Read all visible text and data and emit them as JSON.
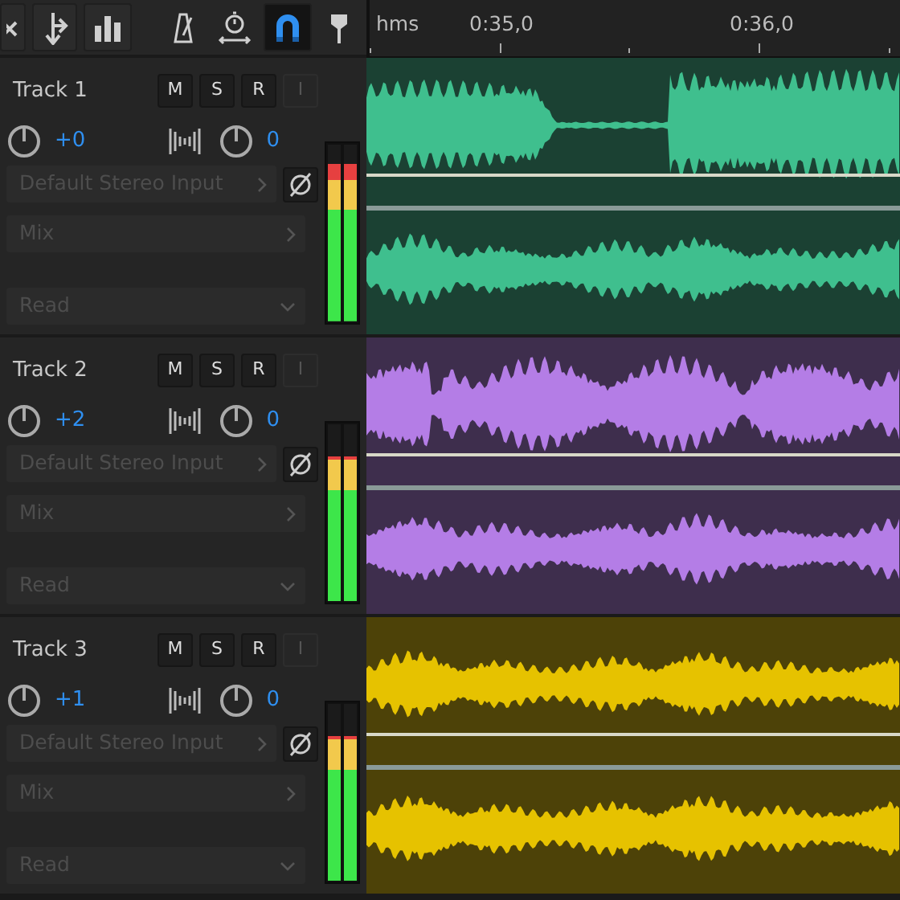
{
  "toolbar": {
    "left_tools": [
      {
        "selected": false
      },
      {
        "selected": false
      },
      {
        "selected": false
      }
    ],
    "right_tools": [
      {
        "selected": false
      },
      {
        "selected": false
      },
      {
        "selected": true
      },
      {
        "selected": false
      }
    ]
  },
  "ruler": {
    "unit": "hms",
    "labels": [
      "0:35,0",
      "0:36,0"
    ]
  },
  "tracks": [
    {
      "name": "Track 1",
      "volume": "+0",
      "pan": "0",
      "buttons": [
        {
          "label": "M",
          "disabled": false
        },
        {
          "label": "S",
          "disabled": false
        },
        {
          "label": "R",
          "disabled": false
        },
        {
          "label": "I",
          "disabled": true
        }
      ],
      "input": "Default Stereo Input",
      "output": "Mix",
      "automation": "Read",
      "meter": {
        "level": 0.89
      },
      "color": "#3fbf8e"
    },
    {
      "name": "Track 2",
      "volume": "+2",
      "pan": "0",
      "buttons": [
        {
          "label": "M",
          "disabled": false
        },
        {
          "label": "S",
          "disabled": false
        },
        {
          "label": "R",
          "disabled": false
        },
        {
          "label": "I",
          "disabled": true
        }
      ],
      "input": "Default Stereo Input",
      "output": "Mix",
      "automation": "Read",
      "meter": {
        "level": 0.82
      },
      "color": "#b47de6"
    },
    {
      "name": "Track 3",
      "volume": "+1",
      "pan": "0",
      "buttons": [
        {
          "label": "M",
          "disabled": false
        },
        {
          "label": "S",
          "disabled": false
        },
        {
          "label": "R",
          "disabled": false
        },
        {
          "label": "I",
          "disabled": true
        }
      ],
      "input": "Default Stereo Input",
      "output": "Mix",
      "automation": "Read",
      "meter": {
        "level": 0.82
      },
      "color": "#e6c200"
    }
  ]
}
